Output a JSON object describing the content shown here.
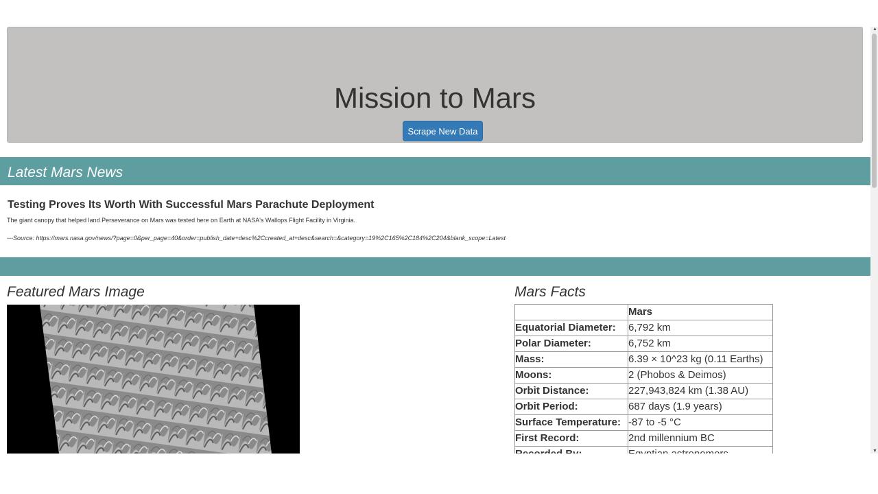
{
  "header": {
    "title": "Mission to Mars",
    "button_label": "Scrape New Data"
  },
  "news": {
    "section_title": "Latest Mars News",
    "headline": "Testing Proves Its Worth With Successful Mars Parachute Deployment",
    "paragraph": "The giant canopy that helped land Perseverance on Mars was tested here on Earth at NASA's Wallops Flight Facility in Virginia.",
    "source": "---Source: https://mars.nasa.gov/news/?page=0&per_page=40&order=publish_date+desc%2Ccreated_at+desc&search=&category=19%2C165%2C184%2C204&blank_scope=Latest"
  },
  "featured": {
    "section_title": "Featured Mars Image"
  },
  "facts": {
    "section_title": "Mars Facts",
    "column_header": "Mars",
    "rows": [
      {
        "label": "Equatorial Diameter:",
        "value": "6,792 km"
      },
      {
        "label": "Polar Diameter:",
        "value": "6,752 km"
      },
      {
        "label": "Mass:",
        "value": "6.39 × 10^23 kg (0.11 Earths)"
      },
      {
        "label": "Moons:",
        "value": "2 (Phobos & Deimos)"
      },
      {
        "label": "Orbit Distance:",
        "value": "227,943,824 km (1.38 AU)"
      },
      {
        "label": "Orbit Period:",
        "value": "687 days (1.9 years)"
      },
      {
        "label": "Surface Temperature:",
        "value": "-87 to -5 °C"
      },
      {
        "label": "First Record:",
        "value": "2nd millennium BC"
      },
      {
        "label": "Recorded By:",
        "value": "Egyptian astronomers"
      }
    ]
  },
  "colors": {
    "jumbotron_bg": "#c2c1bf",
    "band": "#5f9ea0",
    "button": "#337ab7"
  }
}
